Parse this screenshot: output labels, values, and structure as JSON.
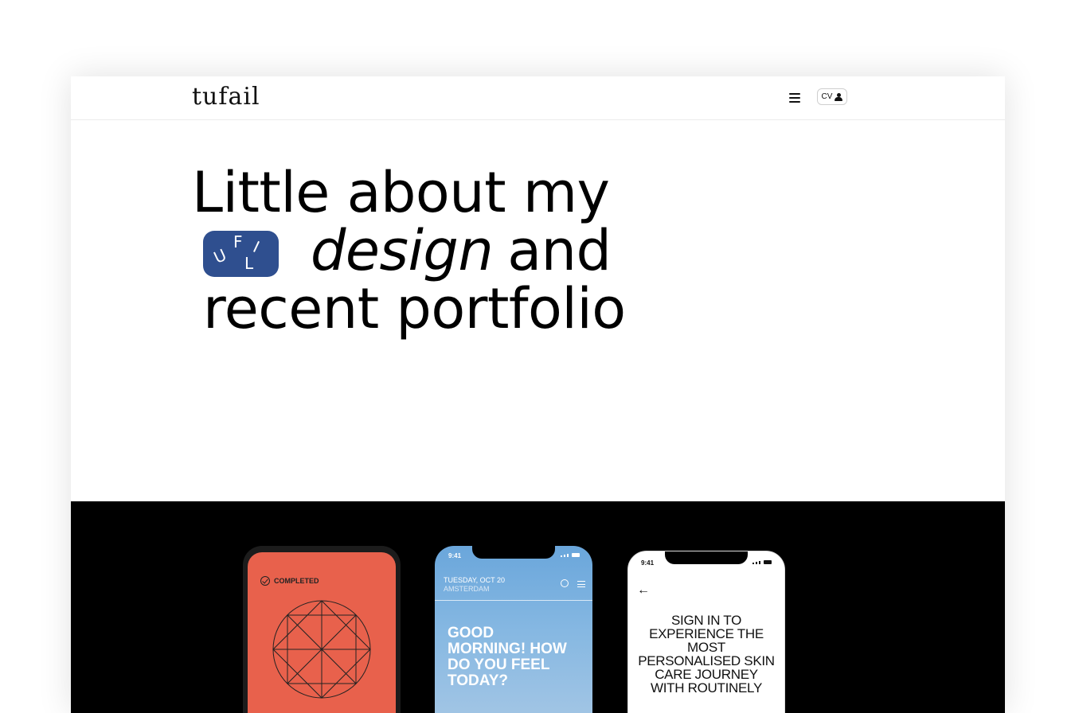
{
  "header": {
    "logo": "tufail",
    "menu_icon": "hamburger-icon",
    "cv_label": "CV",
    "cv_icon": "user-icon"
  },
  "hero": {
    "line1": "Little about my",
    "badge_letters": [
      "U",
      "F",
      "I",
      "L"
    ],
    "line2_em": "design",
    "line2_rest": "and",
    "line3": "recent portfolio"
  },
  "showcase": {
    "phone1": {
      "status": "COMPLETED",
      "color": "#e8614c"
    },
    "phone2": {
      "time": "9:41",
      "date": "TUESDAY, OCT 20",
      "city": "AMSTERDAM",
      "greeting": "GOOD MORNING! HOW DO YOU FEEL TODAY?"
    },
    "phone3": {
      "time": "9:41",
      "headline": "SIGN IN TO EXPERIENCE THE MOST PERSONALISED SKIN CARE JOURNEY WITH ROUTINELY"
    }
  },
  "colors": {
    "badge": "#2f4f8f",
    "dark_section": "#000000"
  }
}
